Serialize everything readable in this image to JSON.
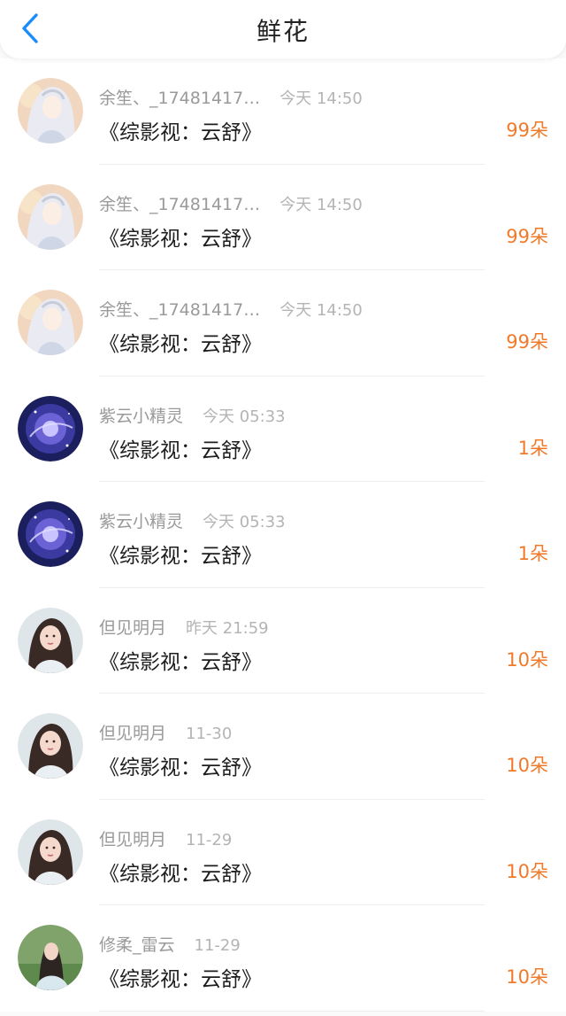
{
  "header": {
    "title": "鲜花",
    "accent_color": "#1a8cff"
  },
  "items": [
    {
      "user": "余笙、_17481417…",
      "time": "今天 14:50",
      "book": "《综影视：云舒》",
      "flowers": "99朵",
      "avatar": "silver-hair-character-avatar"
    },
    {
      "user": "余笙、_17481417…",
      "time": "今天 14:50",
      "book": "《综影视：云舒》",
      "flowers": "99朵",
      "avatar": "silver-hair-character-avatar"
    },
    {
      "user": "余笙、_17481417…",
      "time": "今天 14:50",
      "book": "《综影视：云舒》",
      "flowers": "99朵",
      "avatar": "silver-hair-character-avatar"
    },
    {
      "user": "紫云小精灵",
      "time": "今天 05:33",
      "book": "《综影视：云舒》",
      "flowers": "1朵",
      "avatar": "purple-galaxy-avatar"
    },
    {
      "user": "紫云小精灵",
      "time": "今天 05:33",
      "book": "《综影视：云舒》",
      "flowers": "1朵",
      "avatar": "purple-galaxy-avatar"
    },
    {
      "user": "但见明月",
      "time": "昨天 21:59",
      "book": "《综影视：云舒》",
      "flowers": "10朵",
      "avatar": "girl-portrait-avatar"
    },
    {
      "user": "但见明月",
      "time": "11-30",
      "book": "《综影视：云舒》",
      "flowers": "10朵",
      "avatar": "girl-portrait-avatar"
    },
    {
      "user": "但见明月",
      "time": "11-29",
      "book": "《综影视：云舒》",
      "flowers": "10朵",
      "avatar": "girl-portrait-avatar"
    },
    {
      "user": "修柔_雷云",
      "time": "11-29",
      "book": "《综影视：云舒》",
      "flowers": "10朵",
      "avatar": "green-field-portrait-avatar"
    }
  ],
  "colors": {
    "flowers": "#f07a2a",
    "username": "#9a9a9a",
    "time": "#b4b4b4"
  }
}
